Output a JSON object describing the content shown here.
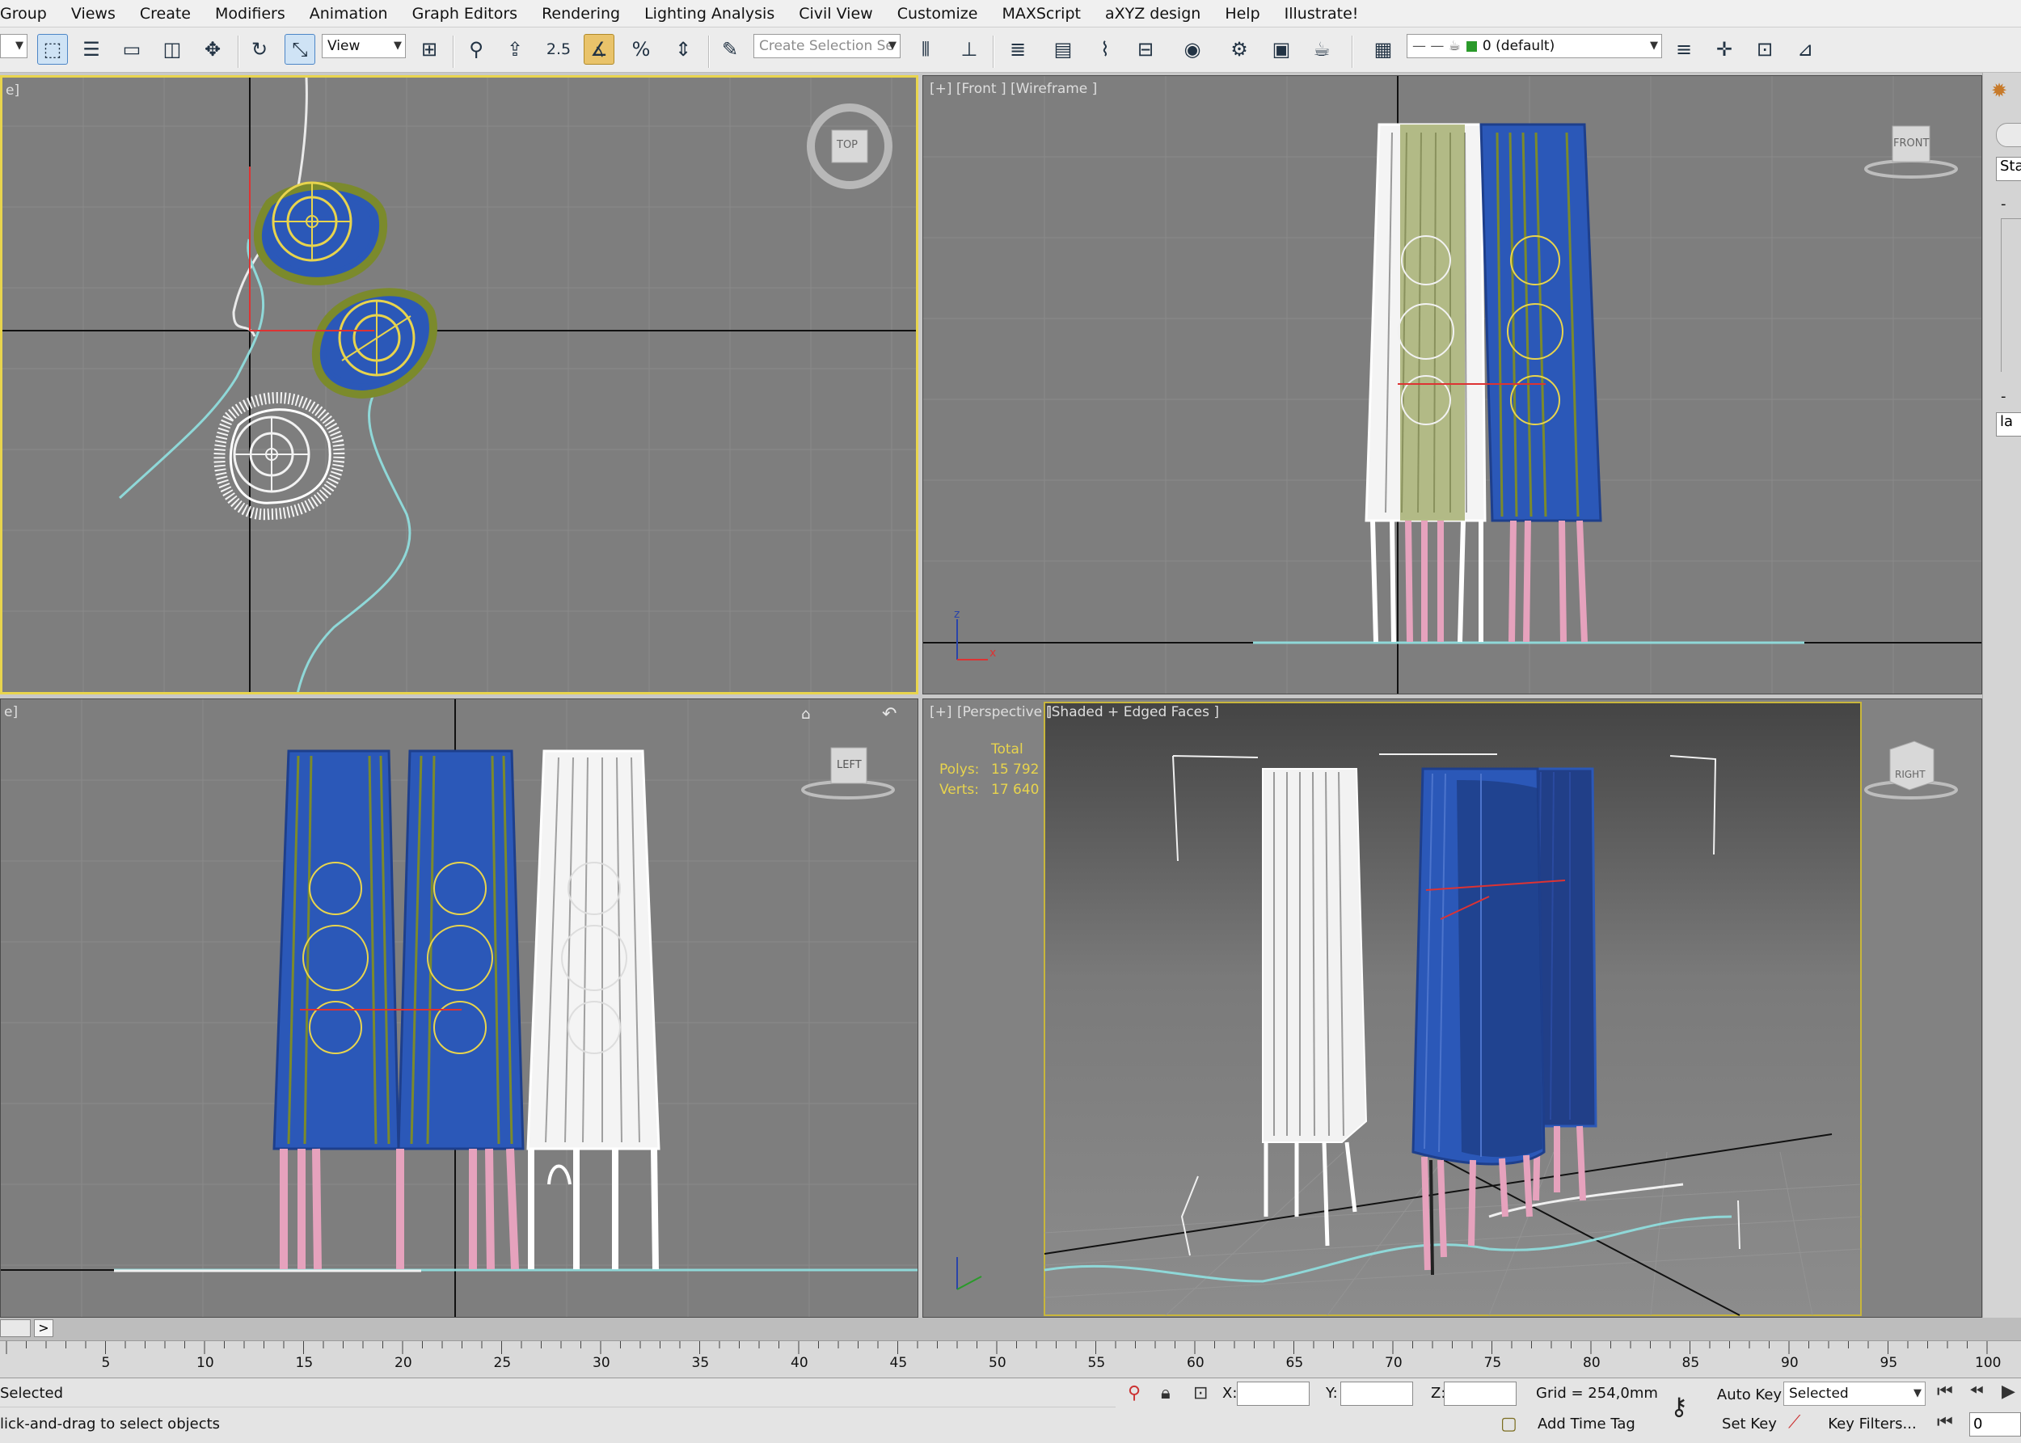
{
  "menu": [
    "Group",
    "Views",
    "Create",
    "Modifiers",
    "Animation",
    "Graph Editors",
    "Rendering",
    "Lighting Analysis",
    "Civil View",
    "Customize",
    "MAXScript",
    "aXYZ design",
    "Help",
    "Illustrate!"
  ],
  "toolbar": {
    "ref_coord": "View",
    "snap_value": "2.5",
    "selection_set_placeholder": "Create Selection Se",
    "layer": "0 (default)"
  },
  "viewports": {
    "top": {
      "label": "e]",
      "navcube": "TOP"
    },
    "front": {
      "label": "[+] [Front ] [Wireframe ]",
      "navcube": "FRONT"
    },
    "left": {
      "label": "e]",
      "navcube": "LEFT"
    },
    "perspective": {
      "label_plus": "[+]",
      "label_view": "[Perspective ]",
      "label_shading": "[Shaded + Edged Faces ]",
      "navcube": "RIGHT",
      "stats": {
        "header": "Total",
        "polys_label": "Polys:",
        "polys_value": "15 792",
        "verts_label": "Verts:",
        "verts_value": "17 640"
      }
    }
  },
  "command_panel": {
    "tab": "Sta",
    "field": "la"
  },
  "timeline": {
    "nav_arrow": ">",
    "ticks": [
      "5",
      "10",
      "15",
      "20",
      "25",
      "30",
      "35",
      "40",
      "45",
      "50",
      "55",
      "60",
      "65",
      "70",
      "75",
      "80",
      "85",
      "90",
      "95",
      "100"
    ]
  },
  "status": {
    "selection": "Selected",
    "prompt": "lick-and-drag to select objects",
    "x_label": "X:",
    "y_label": "Y:",
    "z_label": "Z:",
    "grid": "Grid = 254,0mm",
    "add_time_tag": "Add Time Tag",
    "auto_key": "Auto Key",
    "set_key": "Set Key",
    "key_mode": "Selected",
    "key_filters": "Key Filters...",
    "frame": "0"
  },
  "colors": {
    "viewport_bg": "#7e7e7e",
    "active_border": "#e8d44d",
    "object_blue": "#2b58b8",
    "object_olive": "#7b8a2c",
    "legs_pink": "#e6a2bd",
    "spline_cyan": "#8fd8d8",
    "wire_white": "#ffffff"
  }
}
